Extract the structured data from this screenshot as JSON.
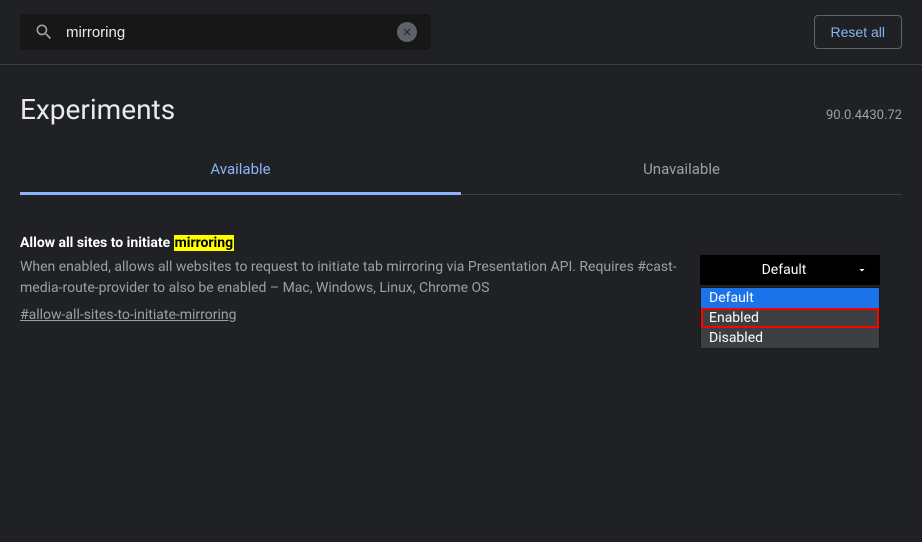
{
  "search": {
    "value": "mirroring"
  },
  "reset_button": "Reset all",
  "page_title": "Experiments",
  "version": "90.0.4430.72",
  "tabs": {
    "available": "Available",
    "unavailable": "Unavailable"
  },
  "flag": {
    "title_prefix": "Allow all sites to initiate ",
    "title_highlight": "mirroring",
    "description": "When enabled, allows all websites to request to initiate tab mirroring via Presentation API. Requires #cast-media-route-provider to also be enabled – Mac, Windows, Linux, Chrome OS",
    "hash": "#allow-all-sites-to-initiate-mirroring"
  },
  "select": {
    "current": "Default",
    "options": {
      "default": "Default",
      "enabled": "Enabled",
      "disabled": "Disabled"
    }
  }
}
